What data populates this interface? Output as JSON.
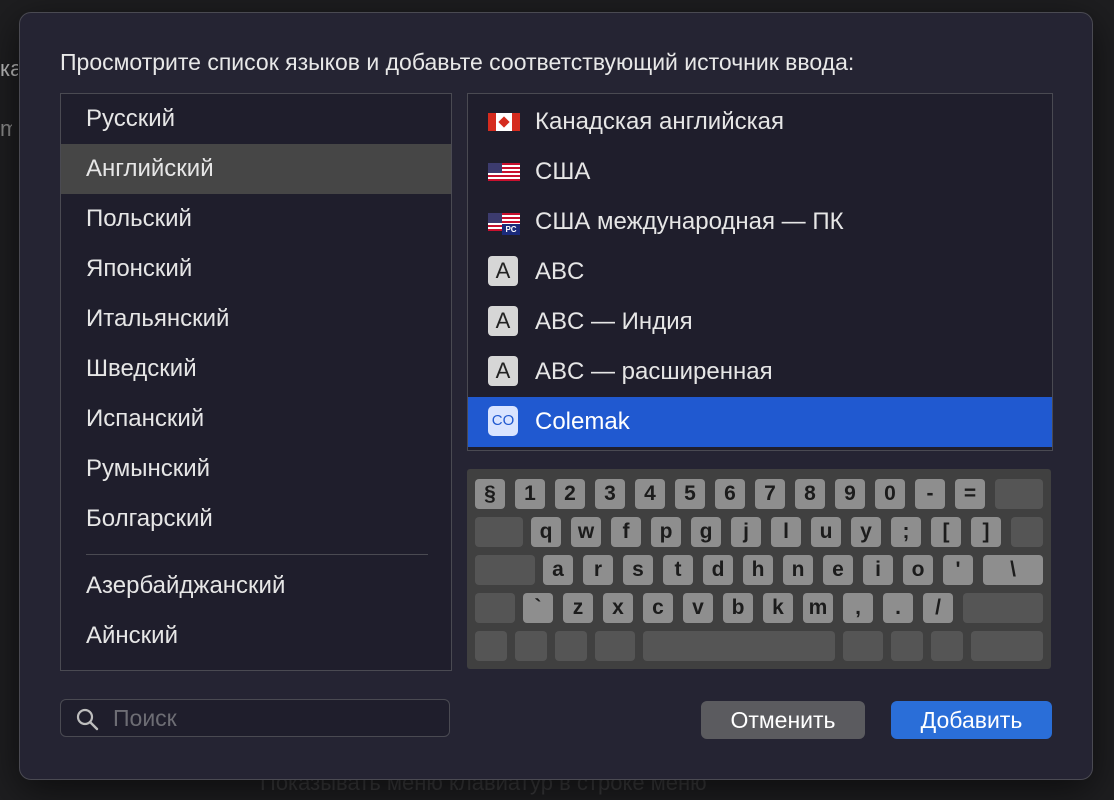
{
  "background": {
    "fragment_1": "ка",
    "fragment_2": "m",
    "bottom_text": "Показывать меню клавиатур в строке меню"
  },
  "dialog": {
    "prompt": "Просмотрите список языков и добавьте соответствующий источник ввода:",
    "languages": [
      {
        "label": "Русский",
        "selected": false
      },
      {
        "label": "Английский",
        "selected": true
      },
      {
        "label": "Польский",
        "selected": false
      },
      {
        "label": "Японский",
        "selected": false
      },
      {
        "label": "Итальянский",
        "selected": false
      },
      {
        "label": "Шведский",
        "selected": false
      },
      {
        "label": "Испанский",
        "selected": false
      },
      {
        "label": "Румынский",
        "selected": false
      },
      {
        "label": "Болгарский",
        "selected": false
      },
      {
        "label": "Азербайджанский",
        "selected": false
      },
      {
        "label": "Айнский",
        "selected": false
      }
    ],
    "input_sources": [
      {
        "label": "Канадская английская",
        "icon": "canada-flag-icon",
        "selected": false
      },
      {
        "label": "США",
        "icon": "us-flag-icon",
        "selected": false
      },
      {
        "label": "США международная — ПК",
        "icon": "us-pc-flag-icon",
        "icon_badge": "PC",
        "selected": false
      },
      {
        "label": "ABC",
        "icon": "letter-a-icon",
        "icon_text": "A",
        "selected": false
      },
      {
        "label": "ABC — Индия",
        "icon": "letter-a-icon",
        "icon_text": "A",
        "selected": false
      },
      {
        "label": "ABC — расширенная",
        "icon": "letter-a-icon",
        "icon_text": "A",
        "selected": false
      },
      {
        "label": "Colemak",
        "icon": "colemak-icon",
        "icon_text": "CO",
        "selected": true
      }
    ],
    "keyboard_rows": [
      [
        "§",
        "1",
        "2",
        "3",
        "4",
        "5",
        "6",
        "7",
        "8",
        "9",
        "0",
        "-",
        "=",
        ""
      ],
      [
        "",
        "q",
        "w",
        "f",
        "p",
        "g",
        "j",
        "l",
        "u",
        "y",
        ";",
        "[",
        "]",
        ""
      ],
      [
        "",
        "a",
        "r",
        "s",
        "t",
        "d",
        "h",
        "n",
        "e",
        "i",
        "o",
        "'",
        "\\"
      ],
      [
        "",
        "`",
        "z",
        "x",
        "c",
        "v",
        "b",
        "k",
        "m",
        ",",
        ".",
        "/",
        ""
      ],
      [
        "",
        "",
        "",
        "",
        "",
        "",
        "",
        "",
        ""
      ]
    ],
    "search": {
      "placeholder": "Поиск",
      "value": ""
    },
    "cancel_label": "Отменить",
    "add_label": "Добавить",
    "colors": {
      "selection": "#2059d0",
      "accent_button": "#2a6ed8"
    }
  }
}
